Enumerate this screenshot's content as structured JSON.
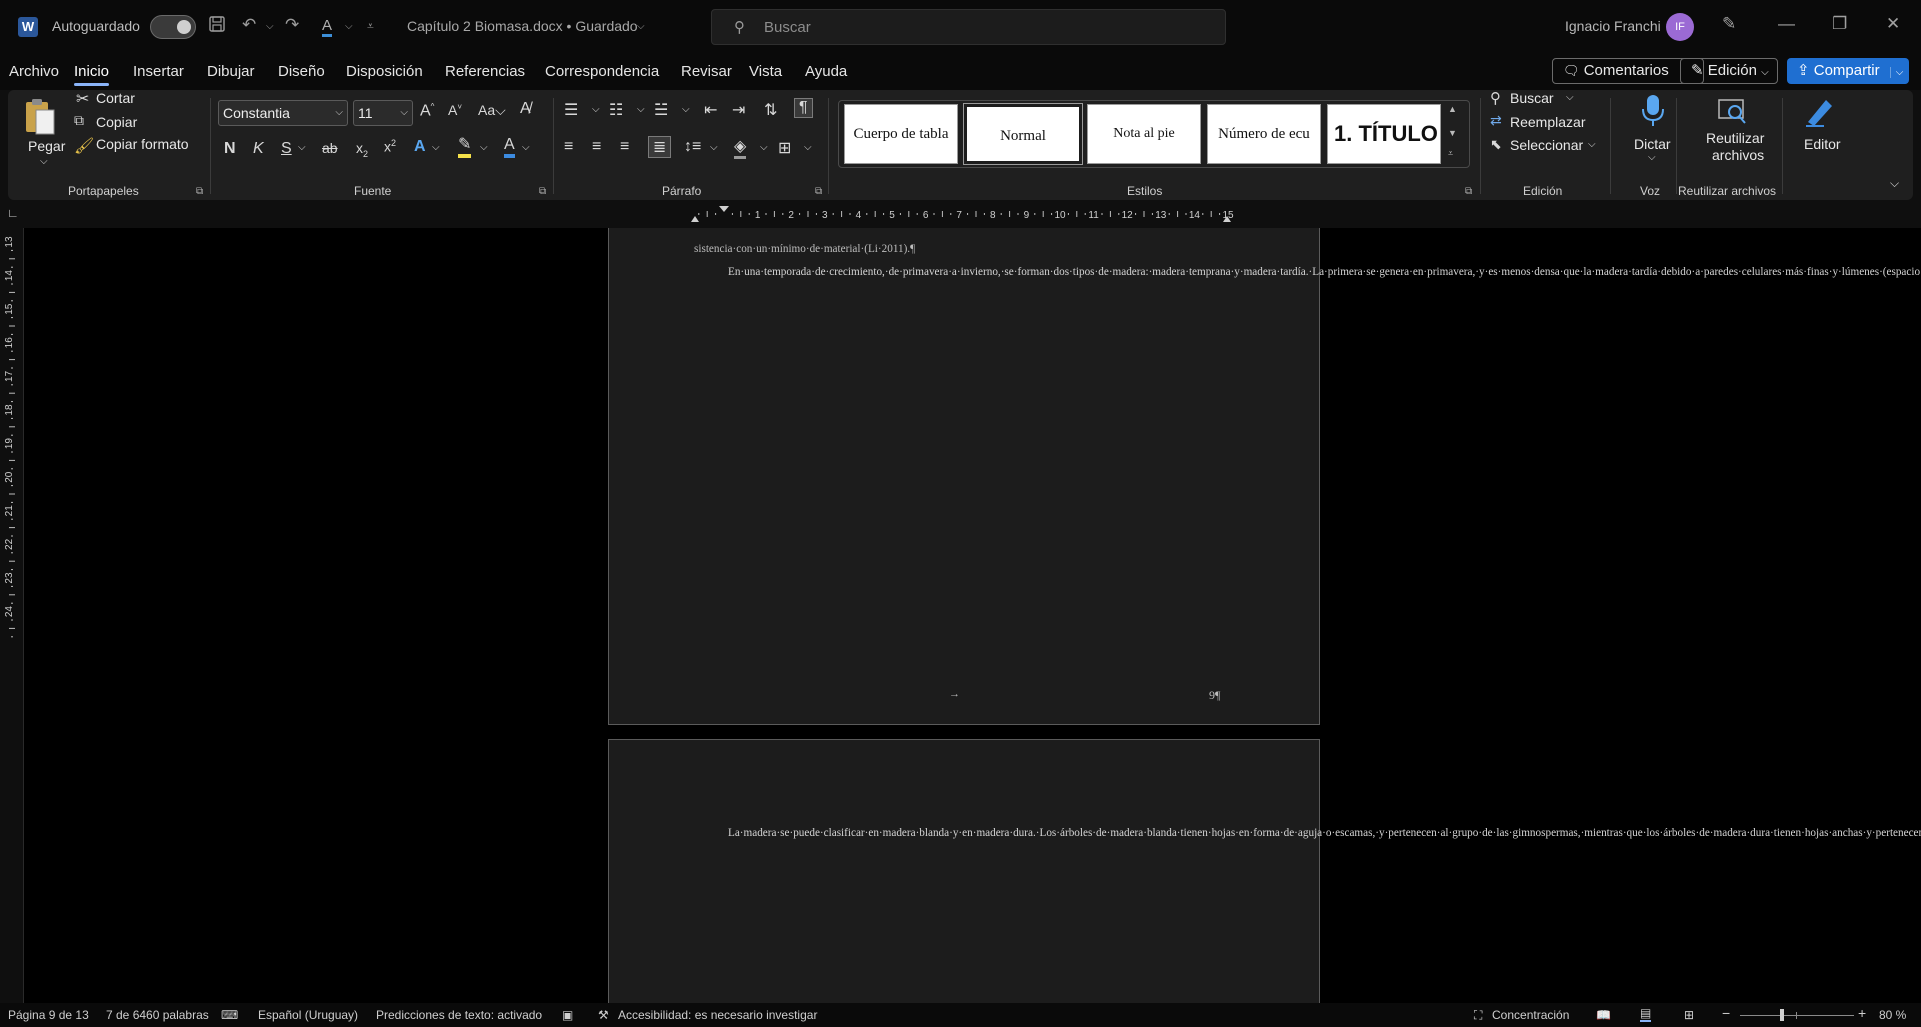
{
  "app": {
    "logo_letter": "W",
    "autosave_label": "Autoguardado",
    "document_title": "Capítulo 2 Biomasa.docx • Guardado",
    "search_placeholder": "Buscar",
    "user_name": "Ignacio Franchi",
    "user_initials": "IF"
  },
  "menu": {
    "tabs": [
      "Archivo",
      "Inicio",
      "Insertar",
      "Dibujar",
      "Diseño",
      "Disposición",
      "Referencias",
      "Correspondencia",
      "Revisar",
      "Vista",
      "Ayuda"
    ],
    "active_tab": "Inicio",
    "comments_label": "Comentarios",
    "edit_label": "Edición",
    "share_label": "Compartir"
  },
  "ribbon": {
    "clipboard": {
      "paste": "Pegar",
      "cut": "Cortar",
      "copy": "Copiar",
      "format_painter": "Copiar formato",
      "group": "Portapapeles"
    },
    "font": {
      "family": "Constantia",
      "size": "11",
      "group": "Fuente"
    },
    "paragraph": {
      "group": "Párrafo"
    },
    "styles": {
      "items": [
        "Cuerpo de tabla",
        "Normal",
        "Nota al pie",
        "Número de ecu",
        "1.  TÍTULO"
      ],
      "selected": "Normal",
      "group": "Estilos"
    },
    "editing": {
      "find": "Buscar",
      "replace": "Reemplazar",
      "select": "Seleccionar",
      "group": "Edición"
    },
    "voice": {
      "dictate": "Dictar",
      "group": "Voz"
    },
    "reuse": {
      "label_line1": "Reutilizar",
      "label_line2": "archivos",
      "group": "Reutilizar archivos"
    },
    "editor": {
      "label": "Editor"
    }
  },
  "ruler": {
    "h_ticks": [
      "1",
      "2",
      "3",
      "4",
      "5",
      "6",
      "7",
      "8",
      "9",
      "10",
      "11",
      "12",
      "13",
      "14",
      "15"
    ],
    "v_ticks": [
      "13",
      "14",
      "15",
      "16",
      "17",
      "18",
      "19",
      "20",
      "21",
      "22",
      "23",
      "24"
    ]
  },
  "document": {
    "page1_top_line": "sistencia·con·un·mínimo·de·material·(Li·2011).¶",
    "page1_paragraph": "En·una·temporada·de·crecimiento,·de·primavera·a·invierno,·se·forman·dos·tipos·de·madera:·madera·temprana·y·madera·tardía.·La·primera·se·genera·en·primavera,·y·es·menos·densa·que·la·madera·tardía·debido·a·paredes·celulares·más·finas·y·lúmenes·(espacio·interior·hueco·de·una·célula·tubular)·más·grandes.·En·cambio,·la·madera·tardía·se·forma·a·fines·del·otoño·y·comienzo·del·invierno·y·contiene·paredes·celulares·más·gruesas·y·lúmenes·más·estrechos.·En·un·anillo·anual·de·crecimiento,·la·relación·entre·madera·temprana·y·madera·tardía·varía·según·las·condiciones·climáticas·y·las·condiciones·de·crecimiento,·lo·que·tiene·implicancias·en·las·propiedades·mecánicas·de·la·madera·(Ansell·2015).¶",
    "footer_tab": "→",
    "page_number": "9¶",
    "page2_paragraph": "La·madera·se·puede·clasificar·en·madera·blanda·y·en·madera·dura.·Los·árboles·de·madera·blanda·tienen·hojas·en·forma·de·aguja·o·escamas,·y·pertenecen·al·grupo·de·las·gimnospermas,·mientras·que·los·árboles·de·madera·dura·tienen·hojas·anchas·y·pertenecen·al·grupo·de·las·angiospermas·(Li·2011).·La·madera·blanda·está·compuesta·por·dos·tipos·de·células,·traqueidas·y·radios·medulares.·Alrededor·del·90·%·de·las·células·de·las·maderas·blandas·son·traqueidas.·Estas·tienen·orificios·que·funcionan·como·válvulas·que·se·abren·y·se·cierran·y·permiten·el·movimiento·de·agua·de·una·traqueida·a·la·otra·en·función·de·la·presión·interna·de·cada·una·de·ellas.·Este·proceso·es·esencial·para·permitir·el·acceso·de·agua·de·célula·a·célula,·desde·las·raíces·a·las·hojas,·en·el·proceso·de·transpiración·(Ansell·2015).·La·madera·dura·es·mucho·más·joven·en·términos·evolutivos·y·su·estructura·celular·es·más·compleja·y·heterogénea·ya·que·pueden·contener·hasta·"
  },
  "status": {
    "page": "Página 9 de 13",
    "words": "7 de 6460 palabras",
    "language": "Español (Uruguay)",
    "predictions": "Predicciones de texto: activado",
    "accessibility": "Accesibilidad: es necesario investigar",
    "focus": "Concentración",
    "zoom": "80 %"
  }
}
